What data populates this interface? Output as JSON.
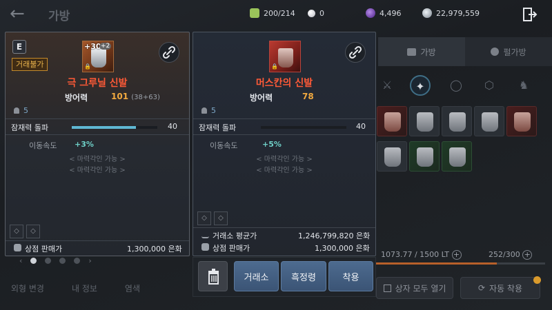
{
  "header": {
    "back_label": "←",
    "title": "가방",
    "currencies": [
      {
        "name": "energy",
        "value": "200/214",
        "color": "#9ac45a",
        "icon": "energy-icon"
      },
      {
        "name": "pearl",
        "value": "0",
        "color": "#cfcfd6",
        "icon": "pearl-icon"
      },
      {
        "name": "crystal",
        "value": "4,496",
        "color": "#7a44c4",
        "icon": "crystal-icon"
      },
      {
        "name": "silver",
        "value": "22,979,559",
        "color": "#b9c3cc",
        "icon": "silver-icon"
      }
    ]
  },
  "background_panel": {
    "tabs": [
      {
        "label": "가방"
      },
      {
        "label": "펄가방"
      }
    ],
    "weight": "1073.77 / 1500 LT",
    "weight_fraction": 0.716,
    "slots": "252/300",
    "open_all_label": "상자 모두 열기",
    "auto_equip_label": "자동 착용"
  },
  "bottom_nav": {
    "items": [
      {
        "label": "외형 변경"
      },
      {
        "label": "내 정보"
      },
      {
        "label": "염색"
      }
    ]
  },
  "equipped_card": {
    "grade": "E",
    "trade_badge": "거래불가",
    "enhance": "+30",
    "enhance_plus": "+2",
    "name": "극 그루닐 신발",
    "defense_label": "방어력",
    "defense_value": "101",
    "defense_extra": "(38+63)",
    "level": "5",
    "stat_label": "잠재력 돌파",
    "stat_value": "40",
    "stat_fraction": 0.75,
    "sub_label": "이동속도",
    "sub_value": "+3%",
    "engrave_1": "< 마력각인 가능 >",
    "engrave_2": "< 마력각인 가능 >",
    "shop_label": "상점 판매가",
    "shop_value": "1,300,000 은화"
  },
  "compare_card": {
    "name": "머스칸의 신발",
    "defense_label": "방어력",
    "defense_value": "78",
    "level": "5",
    "stat_label": "잠재력 돌파",
    "stat_value": "40",
    "stat_fraction": 0.0,
    "sub_label": "이동속도",
    "sub_value": "+5%",
    "engrave_1": "< 마력각인 가능 >",
    "engrave_2": "< 마력각인 가능 >",
    "market_label": "거래소 평균가",
    "market_value": "1,246,799,820 은화",
    "shop_label": "상점 판매가",
    "shop_value": "1,300,000 은화"
  },
  "actions": {
    "market_label": "거래소",
    "black_spirit_label": "흑정령",
    "equip_label": "착용"
  }
}
